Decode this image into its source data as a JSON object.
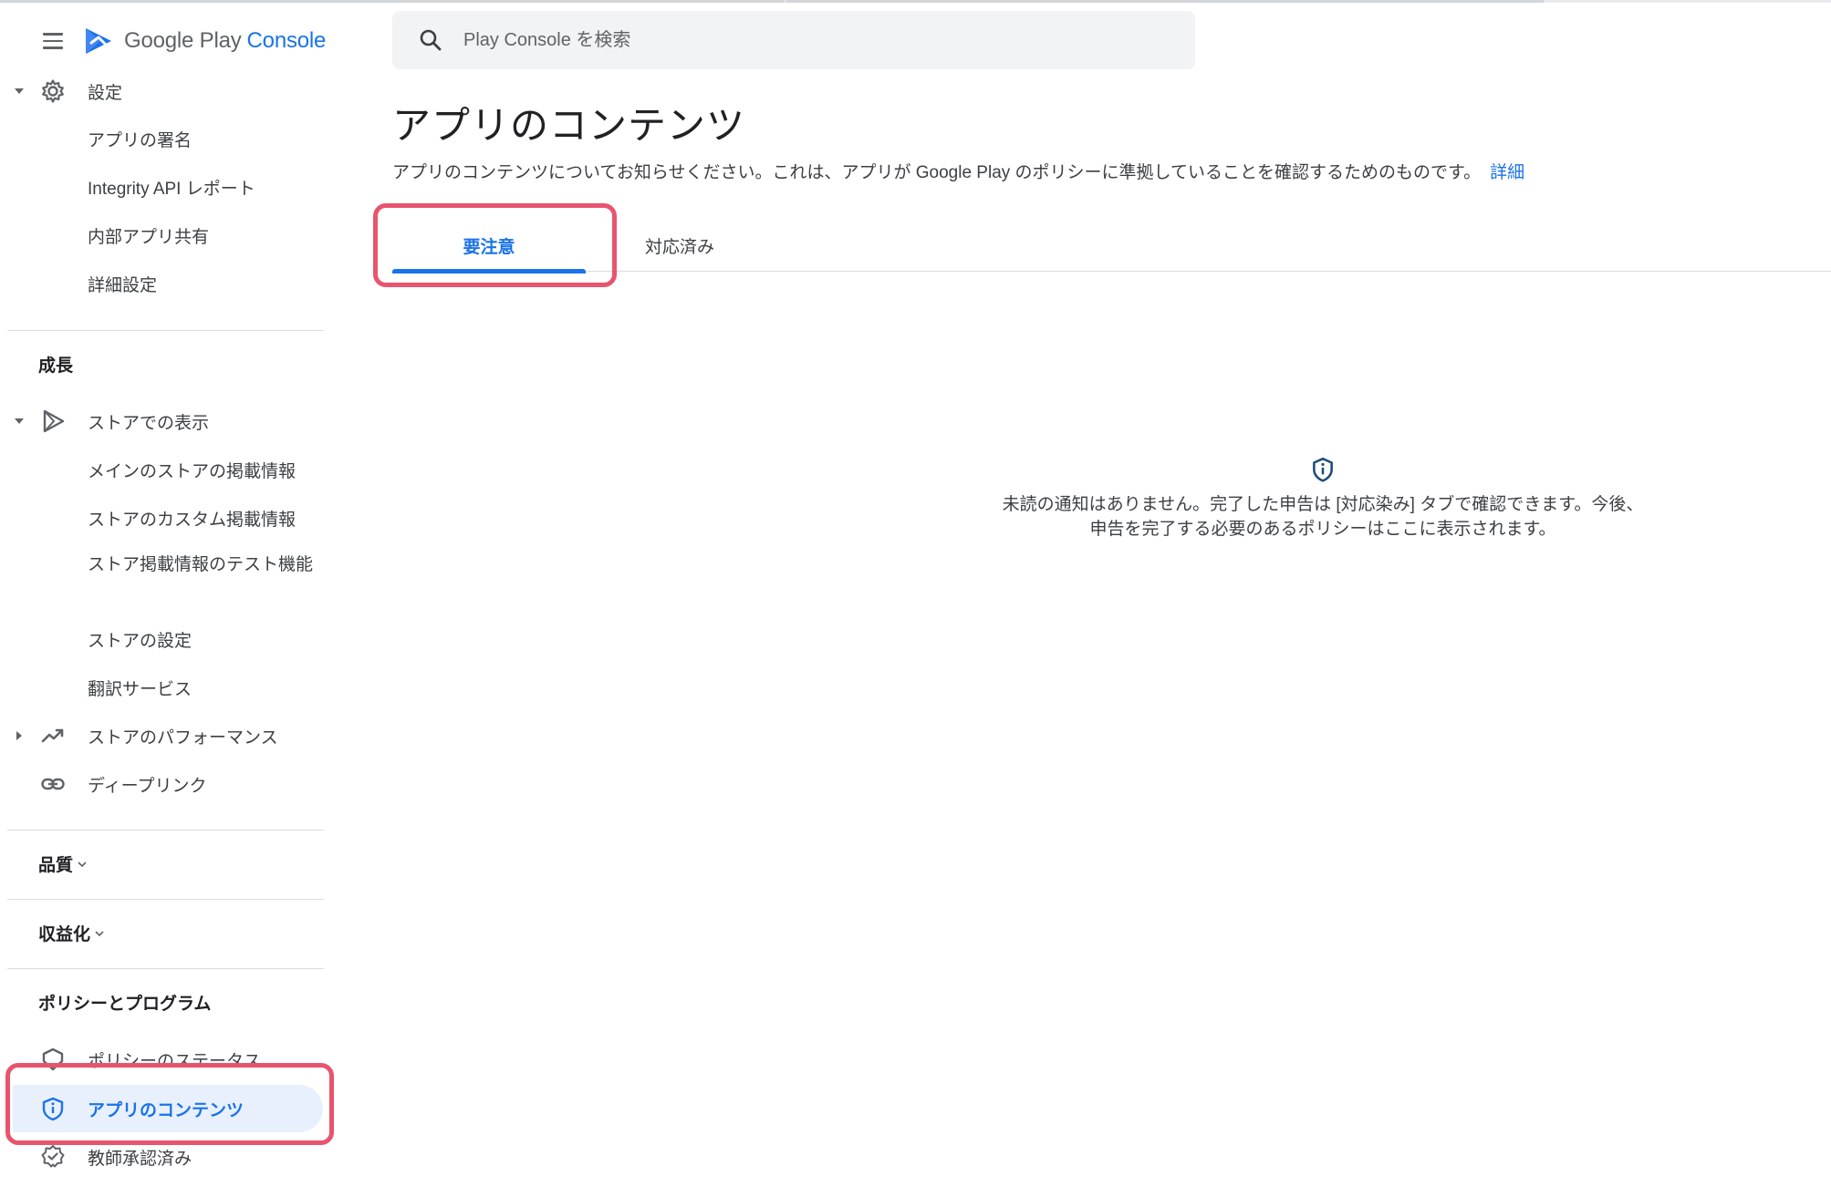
{
  "brand": {
    "name": "Google Play",
    "product": "Console"
  },
  "search": {
    "placeholder": "Play Console を検索"
  },
  "sidebar": {
    "settings": {
      "label": "設定",
      "items": [
        "アプリの署名",
        "Integrity API レポート",
        "内部アプリ共有",
        "詳細設定"
      ]
    },
    "growth": {
      "title": "成長",
      "store_presence": {
        "label": "ストアでの表示",
        "items": [
          "メインのストアの掲載情報",
          "ストアのカスタム掲載情報",
          "ストア掲載情報のテスト機能",
          "ストアの設定",
          "翻訳サービス"
        ]
      },
      "store_performance": "ストアのパフォーマンス",
      "deep_links": "ディープリンク"
    },
    "quality": {
      "title": "品質"
    },
    "monetize": {
      "title": "収益化"
    },
    "policy": {
      "title": "ポリシーとプログラム",
      "items": [
        "ポリシーのステータス",
        "アプリのコンテンツ",
        "教師承認済み"
      ]
    }
  },
  "main": {
    "title": "アプリのコンテンツ",
    "description": "アプリのコンテンツについてお知らせください。これは、アプリが Google Play のポリシーに準拠していることを確認するためのものです。",
    "learn_more": "詳細",
    "tabs": [
      {
        "label": "要注意",
        "selected": true
      },
      {
        "label": "対応済み",
        "selected": false
      }
    ],
    "empty_state": {
      "line1": "未読の通知はありません。完了した申告は [対応染み] タブで確認できます。今後、",
      "line2": "申告を完了する必要のあるポリシーはここに表示されます。"
    }
  },
  "colors": {
    "accent": "#1a73e8",
    "active_bg": "#e8f0fe",
    "highlight": "#e8546d"
  }
}
